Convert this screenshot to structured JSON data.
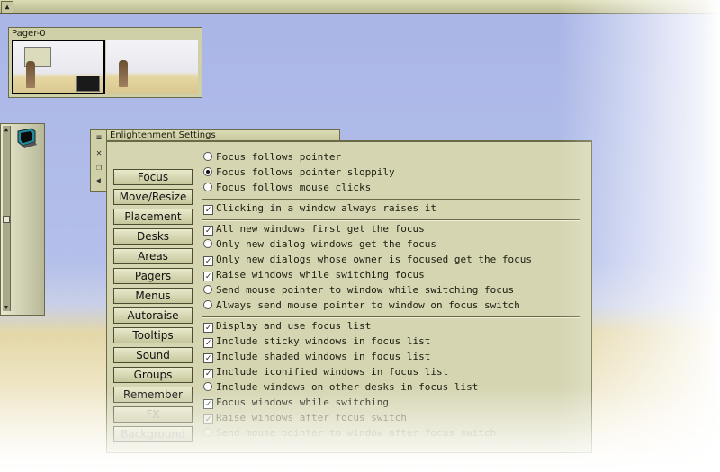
{
  "topbar": {
    "button_glyph": "▲",
    "button_icon": "arrow-up-icon"
  },
  "pager": {
    "title": "Pager-0"
  },
  "settings": {
    "title": "Enlightenment Settings",
    "categories": [
      {
        "label": "Focus",
        "dim": false
      },
      {
        "label": "Move/Resize",
        "dim": false
      },
      {
        "label": "Placement",
        "dim": false
      },
      {
        "label": "Desks",
        "dim": false
      },
      {
        "label": "Areas",
        "dim": false
      },
      {
        "label": "Pagers",
        "dim": false
      },
      {
        "label": "Menus",
        "dim": false
      },
      {
        "label": "Autoraise",
        "dim": false
      },
      {
        "label": "Tooltips",
        "dim": false
      },
      {
        "label": "Sound",
        "dim": false
      },
      {
        "label": "Groups",
        "dim": false
      },
      {
        "label": "Remember",
        "dim": false
      },
      {
        "label": "FX",
        "dim": true
      },
      {
        "label": "Background",
        "dim": true
      }
    ],
    "focus_mode": [
      {
        "label": "Focus follows pointer",
        "selected": false
      },
      {
        "label": "Focus follows pointer sloppily",
        "selected": true
      },
      {
        "label": "Focus follows mouse clicks",
        "selected": false
      }
    ],
    "click_raise": {
      "label": "Clicking in a window always raises it",
      "checked": true
    },
    "new_windows": [
      {
        "label": "All new windows first get the focus",
        "type": "check",
        "checked": true
      },
      {
        "label": "Only new dialog windows get the focus",
        "type": "radio",
        "checked": false
      },
      {
        "label": "Only new dialogs whose owner is focused get the focus",
        "type": "check",
        "checked": true
      },
      {
        "label": "Raise windows while switching focus",
        "type": "check",
        "checked": true
      },
      {
        "label": "Send mouse pointer to window while switching focus",
        "type": "radio",
        "checked": false
      },
      {
        "label": "Always send mouse pointer to window on focus switch",
        "type": "radio",
        "checked": false
      }
    ],
    "focus_list": [
      {
        "label": "Display and use focus list",
        "type": "check",
        "checked": true
      },
      {
        "label": "Include sticky windows in focus list",
        "type": "check",
        "checked": true
      },
      {
        "label": "Include shaded windows in focus list",
        "type": "check",
        "checked": true
      },
      {
        "label": "Include iconified windows in focus list",
        "type": "check",
        "checked": true
      },
      {
        "label": "Include windows on other desks in focus list",
        "type": "radio",
        "checked": false
      },
      {
        "label": "Focus windows while switching",
        "type": "check",
        "checked": true
      },
      {
        "label": "Raise windows after focus switch",
        "type": "check",
        "checked": true
      },
      {
        "label": "Send mouse pointer to window after focus switch",
        "type": "radio",
        "checked": false
      }
    ]
  },
  "icons": {
    "side_buttons": [
      "menu-icon",
      "close-icon",
      "maximize-icon",
      "iconify-icon"
    ],
    "terminal": "terminal-icon"
  },
  "colors": {
    "frame": "#d5d5b2",
    "border": "#6a6a48",
    "sky": "#a9b5e6",
    "sand": "#e3d7a8"
  }
}
